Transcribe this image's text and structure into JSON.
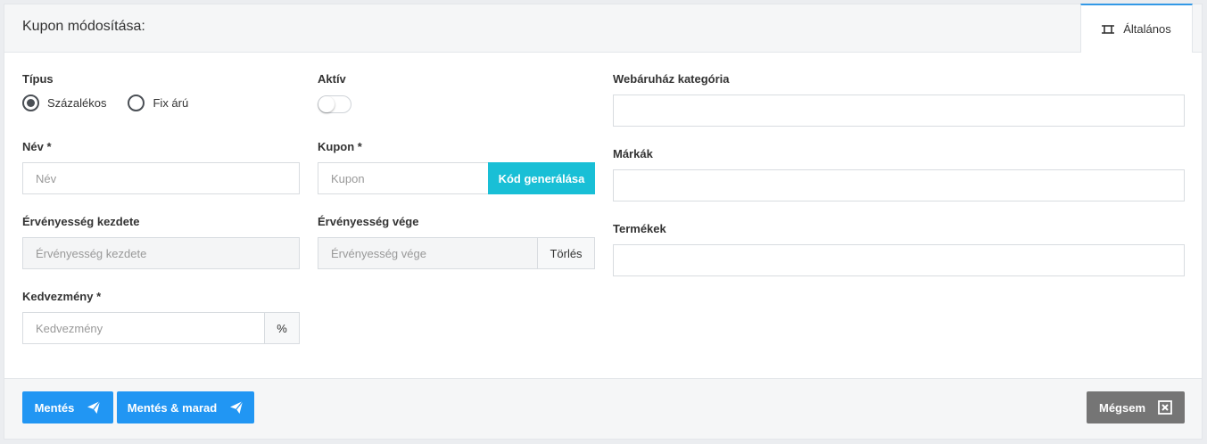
{
  "header": {
    "title": "Kupon módosítása:"
  },
  "tab": {
    "label": "Általános",
    "icon": "expand-icon"
  },
  "form": {
    "type": {
      "label": "Típus",
      "options": [
        {
          "label": "Százalékos",
          "checked": true
        },
        {
          "label": "Fix árú",
          "checked": false
        }
      ]
    },
    "active": {
      "label": "Aktív",
      "on": false
    },
    "name": {
      "label": "Név *",
      "placeholder": "Név"
    },
    "coupon": {
      "label": "Kupon *",
      "placeholder": "Kupon",
      "generate_label": "Kód generálása"
    },
    "valid_from": {
      "label": "Érvényesség kezdete",
      "placeholder": "Érvényesség kezdete"
    },
    "valid_to": {
      "label": "Érvényesség vége",
      "placeholder": "Érvényesség vége",
      "clear_label": "Törlés"
    },
    "discount": {
      "label": "Kedvezmény *",
      "placeholder": "Kedvezmény",
      "unit": "%"
    },
    "shop_category": {
      "label": "Webáruház kategória"
    },
    "brands": {
      "label": "Márkák"
    },
    "products": {
      "label": "Termékek"
    }
  },
  "footer": {
    "save_label": "Mentés",
    "save_stay_label": "Mentés & marad",
    "cancel_label": "Mégsem"
  },
  "colors": {
    "primary": "#2196f3",
    "generate": "#19bfd6",
    "cancel": "#757575",
    "tab_accent": "#3399e6"
  }
}
